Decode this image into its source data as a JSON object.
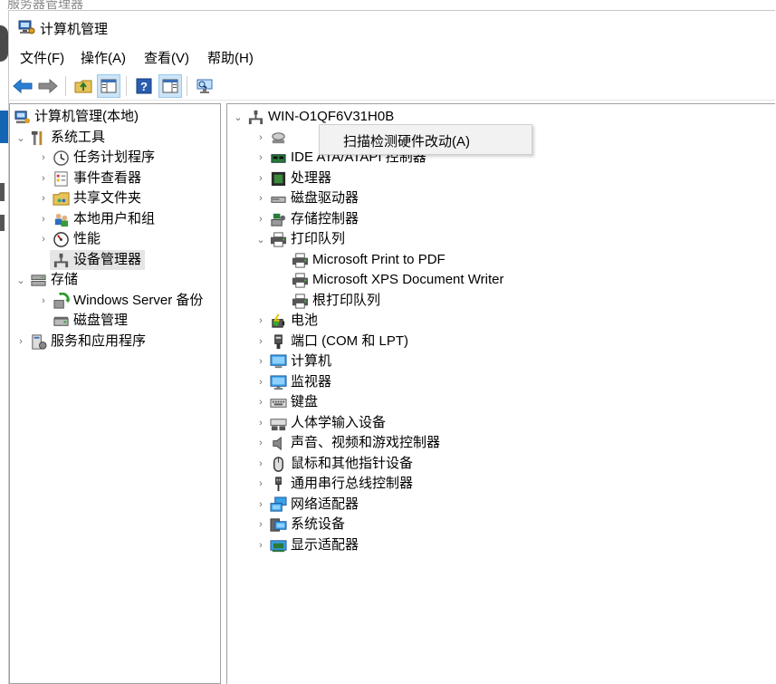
{
  "background_window": {
    "title": "服务器管理器"
  },
  "window": {
    "title": "计算机管理"
  },
  "menubar": [
    {
      "label": "文件(F)"
    },
    {
      "label": "操作(A)"
    },
    {
      "label": "查看(V)"
    },
    {
      "label": "帮助(H)"
    }
  ],
  "toolbar": {
    "buttons": [
      "back-icon",
      "forward-icon",
      "up-folder-icon",
      "show-hide-console-tree-icon",
      "help-icon",
      "action-pane-icon",
      "monitor-icon"
    ]
  },
  "left_tree": [
    {
      "label": "计算机管理(本地)",
      "icon": "computer-management-icon",
      "expand": ""
    },
    {
      "label": "系统工具",
      "icon": "tools-icon",
      "expand": "expanded"
    },
    {
      "label": "任务计划程序",
      "icon": "clock-icon",
      "expand": "collapsed"
    },
    {
      "label": "事件查看器",
      "icon": "event-viewer-icon",
      "expand": "collapsed"
    },
    {
      "label": "共享文件夹",
      "icon": "shared-folder-icon",
      "expand": "collapsed"
    },
    {
      "label": "本地用户和组",
      "icon": "users-icon",
      "expand": "collapsed"
    },
    {
      "label": "性能",
      "icon": "performance-icon",
      "expand": "collapsed"
    },
    {
      "label": "设备管理器",
      "icon": "device-manager-icon",
      "expand": "",
      "selected": true
    },
    {
      "label": "存储",
      "icon": "storage-icon",
      "expand": "expanded"
    },
    {
      "label": "Windows Server 备份",
      "icon": "backup-icon",
      "expand": "collapsed"
    },
    {
      "label": "磁盘管理",
      "icon": "disk-management-icon",
      "expand": ""
    },
    {
      "label": "服务和应用程序",
      "icon": "services-icon",
      "expand": "collapsed"
    }
  ],
  "device_tree": {
    "root_label": "WIN-O1QF6V31H0B",
    "items": [
      {
        "label": "",
        "icon": "drive-icon",
        "expand": "collapsed"
      },
      {
        "label": "IDE ATA/ATAPI 控制器",
        "icon": "ide-controller-icon",
        "expand": "collapsed"
      },
      {
        "label": "处理器",
        "icon": "processor-icon",
        "expand": "collapsed"
      },
      {
        "label": "磁盘驱动器",
        "icon": "disk-drive-icon",
        "expand": "collapsed"
      },
      {
        "label": "存储控制器",
        "icon": "storage-controller-icon",
        "expand": "collapsed"
      },
      {
        "label": "打印队列",
        "icon": "printer-icon",
        "expand": "expanded"
      },
      {
        "label": "Microsoft Print to PDF",
        "icon": "printer-icon",
        "expand": ""
      },
      {
        "label": "Microsoft XPS Document Writer",
        "icon": "printer-icon",
        "expand": ""
      },
      {
        "label": "根打印队列",
        "icon": "printer-icon",
        "expand": ""
      },
      {
        "label": "电池",
        "icon": "battery-icon",
        "expand": "collapsed"
      },
      {
        "label": "端口 (COM 和 LPT)",
        "icon": "port-icon",
        "expand": "collapsed"
      },
      {
        "label": "计算机",
        "icon": "computer-icon",
        "expand": "collapsed"
      },
      {
        "label": "监视器",
        "icon": "monitor-icon",
        "expand": "collapsed"
      },
      {
        "label": "键盘",
        "icon": "keyboard-icon",
        "expand": "collapsed"
      },
      {
        "label": "人体学输入设备",
        "icon": "hid-icon",
        "expand": "collapsed"
      },
      {
        "label": "声音、视频和游戏控制器",
        "icon": "speaker-icon",
        "expand": "collapsed"
      },
      {
        "label": "鼠标和其他指针设备",
        "icon": "mouse-icon",
        "expand": "collapsed"
      },
      {
        "label": "通用串行总线控制器",
        "icon": "usb-icon",
        "expand": "collapsed"
      },
      {
        "label": "网络适配器",
        "icon": "network-adapter-icon",
        "expand": "collapsed"
      },
      {
        "label": "系统设备",
        "icon": "system-devices-icon",
        "expand": "collapsed"
      },
      {
        "label": "显示适配器",
        "icon": "display-adapter-icon",
        "expand": "collapsed"
      }
    ]
  },
  "context_menu": {
    "item": "扫描检测硬件改动(A)"
  },
  "colors": {
    "selection": "#e5e5e5",
    "accent": "#0078d7",
    "menu_bg": "#f2f2f2"
  }
}
